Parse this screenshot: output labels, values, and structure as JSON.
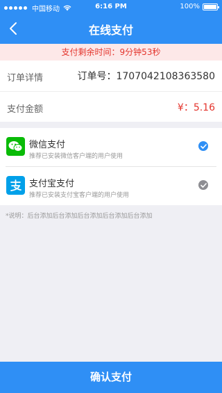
{
  "status_bar": {
    "carrier": "中国移动",
    "time": "6:16 PM",
    "battery": "100%"
  },
  "navbar": {
    "title": "在线支付"
  },
  "countdown": {
    "text": "支付剩余时间：9分钟53秒"
  },
  "order": {
    "detail_label": "订单详情",
    "order_no_text": "订单号：1707042108363580",
    "amount_label": "支付金额",
    "amount_value": "¥：5.16"
  },
  "payment_methods": [
    {
      "name": "微信支付",
      "desc": "推荐已安装微信客户端的用户使用",
      "selected": true,
      "icon": "wechat-pay-icon"
    },
    {
      "name": "支付宝支付",
      "desc": "推荐已安装支付宝客户端的用户使用",
      "selected": false,
      "icon": "alipay-icon"
    }
  ],
  "note": "*说明：后台添加后台添加后台添加后台添加后台添加",
  "confirm_button": "确认支付",
  "colors": {
    "primary": "#2f8ff5",
    "accent_red": "#e4342c",
    "wechat_green": "#09bb07",
    "alipay_blue": "#00a0e9"
  }
}
